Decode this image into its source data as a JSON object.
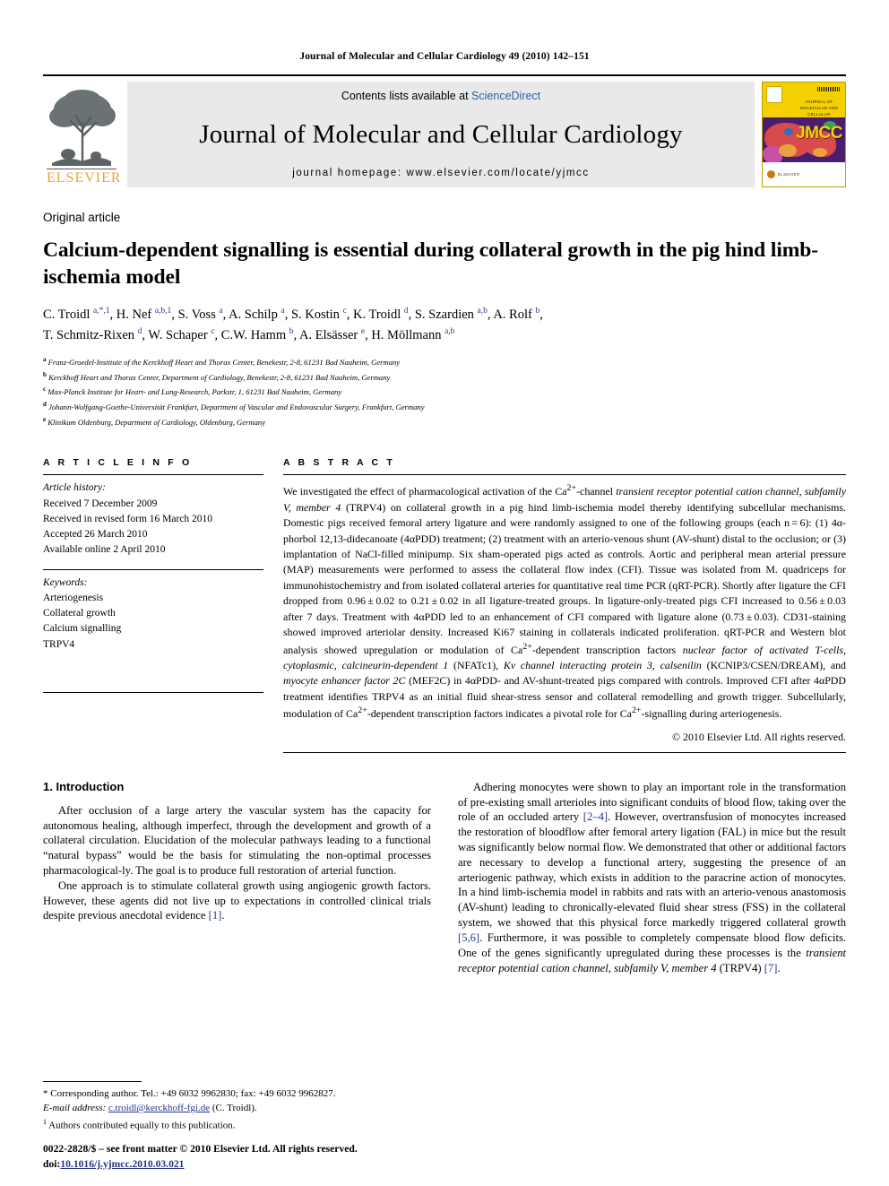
{
  "running_head": "Journal of Molecular and Cellular Cardiology 49 (2010) 142–151",
  "masthead": {
    "publisher_name": "ELSEVIER",
    "contents_prefix": "Contents lists available at ",
    "contents_link": "ScienceDirect",
    "journal_title": "Journal of Molecular and Cellular Cardiology",
    "homepage": "journal homepage: www.elsevier.com/locate/yjmcc",
    "cover_title_lines": "JOURNAL OF MOLECULAR AND CELLULAR CARDIOLOGY",
    "cover_acronym": "JMCC",
    "cover_bottom_text": "ELSEVIER"
  },
  "article": {
    "type": "Original article",
    "title": "Calcium-dependent signalling is essential during collateral growth in the pig hind limb-ischemia model",
    "authors_line_1": "C. Troidl a,*,1, H. Nef a,b,1, S. Voss a, A. Schilp a, S. Kostin c, K. Troidl d, S. Szardien a,b, A. Rolf b,",
    "authors_line_2": "T. Schmitz-Rixen d, W. Schaper c, C.W. Hamm b, A. Elsässer e, H. Möllmann a,b",
    "affiliations": [
      {
        "mark": "a",
        "text": "Franz-Groedel-Institute of the Kerckhoff Heart and Thorax Center, Benekestr, 2-8, 61231 Bad Nauheim, Germany"
      },
      {
        "mark": "b",
        "text": "Kerckhoff Heart and Thorax Center, Department of Cardiology, Benekestr, 2-8, 61231 Bad Nauheim, Germany"
      },
      {
        "mark": "c",
        "text": "Max-Planck Institute for Heart- and Lung-Research, Parkstr, 1, 61231 Bad Nauheim, Germany"
      },
      {
        "mark": "d",
        "text": "Johann-Wolfgang-Goethe-Universität Frankfurt, Department of Vascular and Endovascular Surgery, Frankfurt, Germany"
      },
      {
        "mark": "e",
        "text": "Klinikum Oldenburg, Department of Cardiology, Oldenburg, Germany"
      }
    ]
  },
  "article_info": {
    "heading": "A R T I C L E  I N F O",
    "history_label": "Article history:",
    "history": [
      "Received 7 December 2009",
      "Received in revised form 16 March 2010",
      "Accepted 26 March 2010",
      "Available online 2 April 2010"
    ],
    "keywords_label": "Keywords:",
    "keywords": [
      "Arteriogenesis",
      "Collateral growth",
      "Calcium signalling",
      "TRPV4"
    ]
  },
  "abstract": {
    "heading": "A B S T R A C T",
    "text_parts": [
      {
        "t": "We investigated the effect of pharmacological activation of the Ca",
        "s": "normal"
      },
      {
        "t": "2+",
        "s": "sup"
      },
      {
        "t": "-channel ",
        "s": "normal"
      },
      {
        "t": "transient receptor potential cation channel, subfamily V, member 4",
        "s": "italic"
      },
      {
        "t": " (TRPV4) on collateral growth in a pig hind limb-ischemia model thereby identifying subcellular mechanisms. Domestic pigs received femoral artery ligature and were randomly assigned to one of the following groups (each n = 6): (1) 4α-phorbol 12,13-didecanoate (4αPDD) treatment; (2) treatment with an arterio-venous shunt (AV-shunt) distal to the occlusion; or (3) implantation of NaCl-filled minipump. Six sham-operated pigs acted as controls. Aortic and peripheral mean arterial pressure (MAP) measurements were performed to assess the collateral flow index (CFI). Tissue was isolated from M. quadriceps for immunohistochemistry and from isolated collateral arteries for quantitative real time PCR (qRT-PCR). Shortly after ligature the CFI dropped from 0.96 ± 0.02 to 0.21 ± 0.02 in all ligature-treated groups. In ligature-only-treated pigs CFI increased to 0.56 ± 0.03 after 7 days. Treatment with 4αPDD led to an enhancement of CFI compared with ligature alone (0.73 ± 0.03). CD31-staining showed improved arteriolar density. Increased Ki67 staining in collaterals indicated proliferation. qRT-PCR and Western blot analysis showed upregulation or modulation of Ca",
        "s": "normal"
      },
      {
        "t": "2+",
        "s": "sup"
      },
      {
        "t": "-dependent transcription factors ",
        "s": "normal"
      },
      {
        "t": "nuclear factor of activated T-cells, cytoplasmic, calcineurin-dependent 1",
        "s": "italic"
      },
      {
        "t": " (NFATc1), ",
        "s": "normal"
      },
      {
        "t": "Kv channel interacting protein 3, calsenilin",
        "s": "italic"
      },
      {
        "t": " (KCNIP3/CSEN/DREAM), and ",
        "s": "normal"
      },
      {
        "t": "myocyte enhancer factor 2C",
        "s": "italic"
      },
      {
        "t": " (MEF2C) in 4αPDD- and AV-shunt-treated pigs compared with controls. Improved CFI after 4αPDD treatment identifies TRPV4 as an initial fluid shear-stress sensor and collateral remodelling and growth trigger. Subcellularly, modulation of Ca",
        "s": "normal"
      },
      {
        "t": "2+",
        "s": "sup"
      },
      {
        "t": "-dependent transcription factors indicates a pivotal role for Ca",
        "s": "normal"
      },
      {
        "t": "2+",
        "s": "sup"
      },
      {
        "t": "-signalling during arteriogenesis.",
        "s": "normal"
      }
    ],
    "copyright": "© 2010 Elsevier Ltd. All rights reserved."
  },
  "introduction": {
    "heading": "1. Introduction",
    "left_paragraphs": [
      "After occlusion of a large artery the vascular system has the capacity for autonomous healing, although imperfect, through the development and growth of a collateral circulation. Elucidation of the molecular pathways leading to a functional “natural bypass” would be the basis for stimulating the non-optimal processes pharmacological-ly. The goal is to produce full restoration of arterial function.",
      "One approach is to stimulate collateral growth using angiogenic growth factors. However, these agents did not live up to expectations in controlled clinical trials despite previous anecdotal evidence [1]."
    ],
    "right_text_parts": [
      {
        "t": "Adhering monocytes were shown to play an important role in the transformation of pre-existing small arterioles into significant conduits of blood flow, taking over the role of an occluded artery ",
        "s": "normal"
      },
      {
        "t": "[2–4]",
        "s": "ref"
      },
      {
        "t": ". However, overtransfusion of monocytes increased the restoration of bloodflow after femoral artery ligation (FAL) in mice but the result was significantly below normal flow. We demonstrated that other or additional factors are necessary to develop a functional artery, suggesting the presence of an arteriogenic pathway, which exists in addition to the paracrine action of monocytes. In a hind limb-ischemia model in rabbits and rats with an arterio-venous anastomosis (AV-shunt) leading to chronically-elevated fluid shear stress (FSS) in the collateral system, we showed that this physical force markedly triggered collateral growth ",
        "s": "normal"
      },
      {
        "t": "[5,6]",
        "s": "ref"
      },
      {
        "t": ". Furthermore, it was possible to completely compensate blood flow deficits. One of the genes significantly upregulated during these processes is the ",
        "s": "normal"
      },
      {
        "t": "transient receptor potential cation channel, subfamily V, member 4",
        "s": "italic"
      },
      {
        "t": " (TRPV4) ",
        "s": "normal"
      },
      {
        "t": "[7]",
        "s": "ref"
      },
      {
        "t": ".",
        "s": "normal"
      }
    ],
    "left_ref_marker": "[1]"
  },
  "footnotes": {
    "corresponding": "* Corresponding author. Tel.: +49 6032 9962830; fax: +49 6032 9962827.",
    "email_label": "E-mail address:",
    "email": "c.troidl@kerckhoff-fgi.de",
    "email_suffix": "(C. Troidl).",
    "equal_contrib": "1  Authors contributed equally to this publication."
  },
  "imprint": {
    "line1": "0022-2828/$ – see front matter © 2010 Elsevier Ltd. All rights reserved.",
    "doi_label": "doi:",
    "doi": "10.1016/j.yjmcc.2010.03.021"
  }
}
